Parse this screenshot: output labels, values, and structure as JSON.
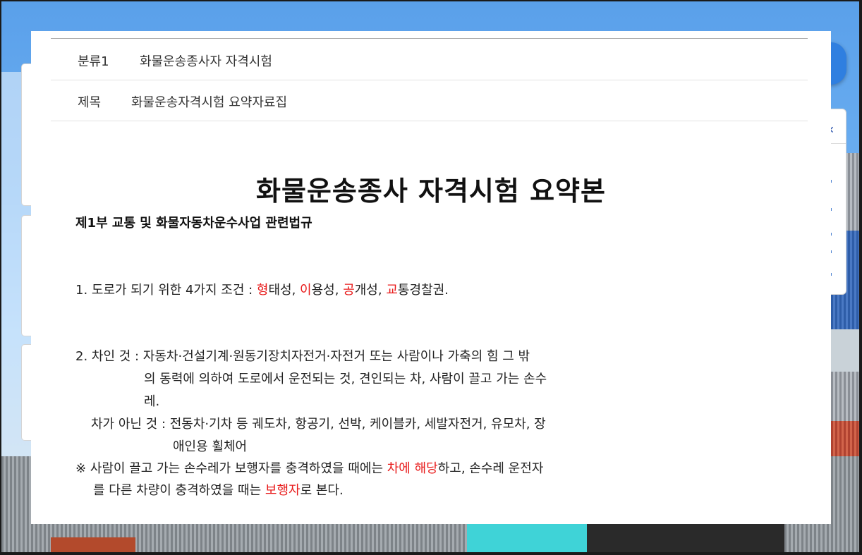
{
  "meta": {
    "category_label": "분류1",
    "category_value": "화물운송종사자 자격시험",
    "subject_label": "제목",
    "subject_value": "화물운송자격시험 요약자료집"
  },
  "document": {
    "title": "화물운송종사 자격시험 요약본",
    "part_title": "제1부 교통 및 화물자동차운수사업 관련법규",
    "item1": {
      "prefix": "1. 도로가 되기 위한 4가지 조건 : ",
      "r1": "형",
      "t1": "태성, ",
      "r2": "이",
      "t2": "용성, ",
      "r3": "공",
      "t3": "개성, ",
      "r4": "교",
      "t4": "통경찰권."
    },
    "item2": {
      "line1": "2. 차인 것 : 자동차·건설기계·원동기장치자전거·자전거 또는 사람이나 가축의 힘 그 밖",
      "line2": "의 동력에 의하여 도로에서 운전되는 것, 견인되는 차, 사람이 끌고 가는 손수",
      "line3": "레.",
      "line4": "차가 아닌 것 : 전동차·기차 등 궤도차, 항공기, 선박, 케이블카, 세발자전거, 유모차, 장",
      "line5": "애인용 휠체어"
    },
    "note": {
      "a": "※ 사람이 끌고 가는 손수레가 보행자를 충격하였을 때에는 ",
      "r1": "차에 해당",
      "b": "하고, 손수레 운전자",
      "c": "를 다른 차량이 충격하였을 때는 ",
      "r2": "보행자",
      "d": "로 본다."
    }
  },
  "colors": {
    "highlight": "#e81a1a",
    "float_button": "#2f7fe0"
  }
}
